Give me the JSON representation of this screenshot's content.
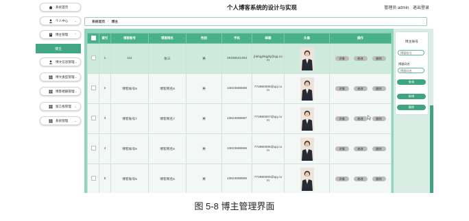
{
  "header": {
    "title": "个人博客系统的设计与实现",
    "user_label": "管理员 admin",
    "logout_label": "退出登录"
  },
  "sidebar": {
    "items": [
      {
        "label": "系统首页",
        "icon": "home-icon"
      },
      {
        "label": "个人中心",
        "icon": "user-icon"
      },
      {
        "label": "博主管理",
        "icon": "doc-icon"
      },
      {
        "label": "博主",
        "active": true
      },
      {
        "label": "博文信息管理",
        "icon": "user-icon"
      },
      {
        "label": "博文类型管理",
        "icon": "grid-icon"
      },
      {
        "label": "博客相册管理",
        "icon": "grid-icon"
      },
      {
        "label": "留言板管理",
        "icon": "grid-icon"
      },
      {
        "label": "系统管理",
        "icon": "grid-icon"
      }
    ]
  },
  "breadcrumb": {
    "home": "系统首页",
    "current": "博主"
  },
  "table": {
    "columns": [
      "",
      "索引",
      "博客账号",
      "博客网名",
      "性别",
      "手机",
      "邮箱",
      "头像",
      "操作"
    ],
    "rows": [
      {
        "index": "1",
        "account": "111",
        "name": "张三",
        "gender": "男",
        "phone": "18156541454",
        "email": "jhkhjghkjghj@qq.com",
        "avatar": "avatar-photo"
      },
      {
        "index": "2",
        "account": "博客账号8",
        "name": "博客网名8",
        "gender": "男",
        "phone": "13823888888",
        "email": "773890008@qq.com",
        "avatar": "avatar-photo"
      },
      {
        "index": "3",
        "account": "博客账号7",
        "name": "博客网名7",
        "gender": "男",
        "phone": "13823888887",
        "email": "773890007@qq.com",
        "avatar": "avatar-photo"
      },
      {
        "index": "4",
        "account": "博客账号6",
        "name": "博客网名6",
        "gender": "男",
        "phone": "13823888886",
        "email": "773890006@qq.com",
        "avatar": "avatar-photo"
      },
      {
        "index": "5",
        "account": "博客账号5",
        "name": "博客网名5",
        "gender": "男",
        "phone": "13823888885",
        "email": "773890005@qq.com",
        "avatar": "avatar-photo"
      }
    ],
    "actions": {
      "detail": "详情",
      "edit": "修改",
      "delete": "删除"
    }
  },
  "search_panel": {
    "title": "博主账号",
    "account_placeholder": "博客账号",
    "name_label": "博客网名",
    "name_placeholder": "博客网名",
    "search_label": "查询",
    "add_label": "新增",
    "delete_label": "删除"
  },
  "caption": "图 5-8 博主管理界面",
  "colors": {
    "accent": "#42a784",
    "header": "#48b08a",
    "panel": "#8fd5bc"
  }
}
